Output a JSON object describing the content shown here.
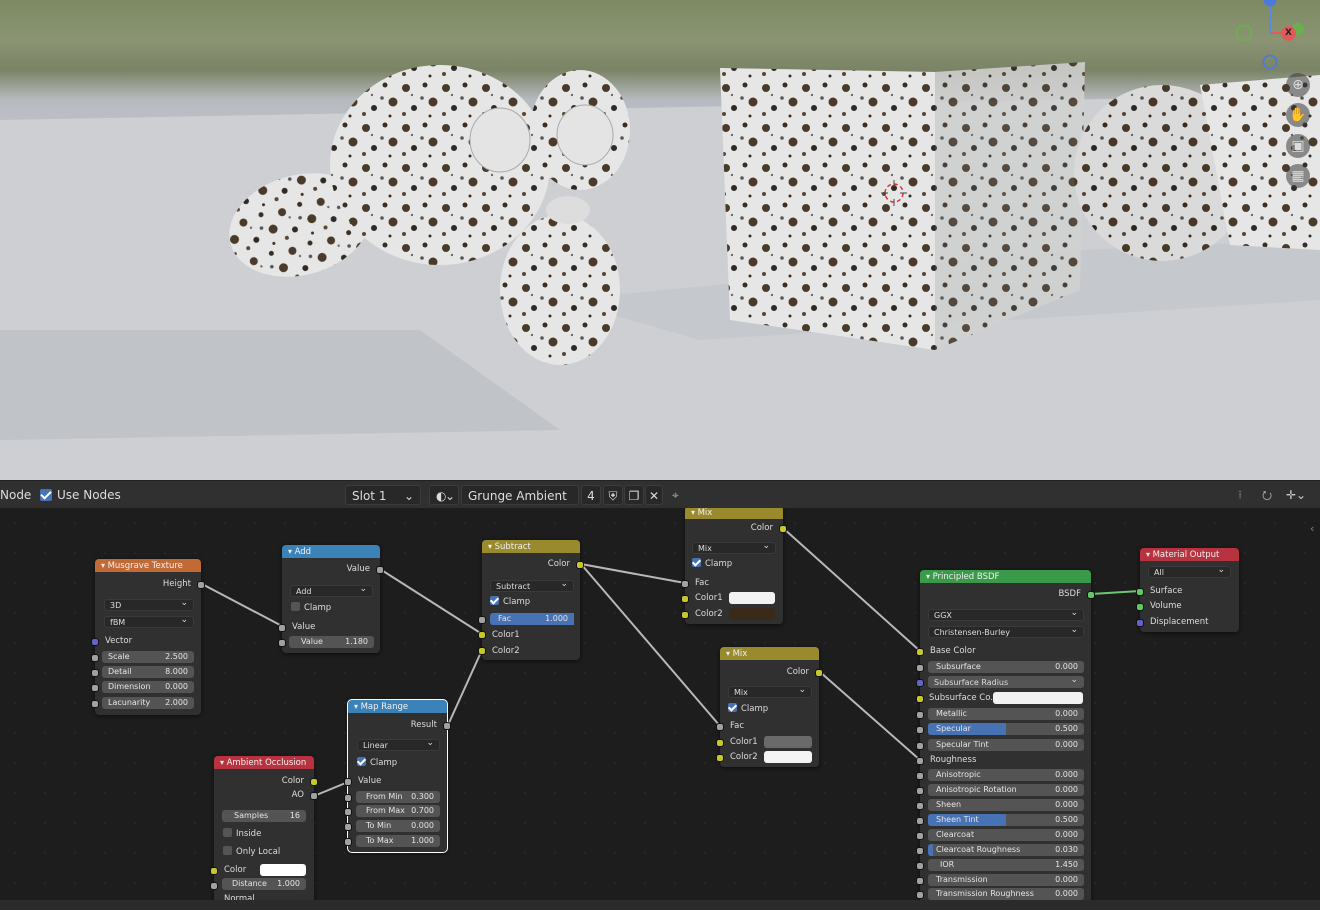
{
  "header": {
    "editor_label": "Node",
    "use_nodes_label": "Use Nodes",
    "slot": "Slot 1",
    "material_name": "Grunge Ambient",
    "user_count": "4"
  },
  "nodes": {
    "musgrave": {
      "title": "Musgrave Texture",
      "output_height": "Height",
      "dim": "3D",
      "type": "fBM",
      "vector": "Vector",
      "scale_label": "Scale",
      "scale": "2.500",
      "detail_label": "Detail",
      "detail": "8.000",
      "dimension_label": "Dimension",
      "dimension": "0.000",
      "lacunarity_label": "Lacunarity",
      "lacunarity": "2.000"
    },
    "add": {
      "title": "Add",
      "output_value": "Value",
      "op": "Add",
      "clamp": "Clamp",
      "input_value": "Value",
      "value_label": "Value",
      "value": "1.180"
    },
    "subtract": {
      "title": "Subtract",
      "output_color": "Color",
      "op": "Subtract",
      "clamp": "Clamp",
      "fac_label": "Fac",
      "fac": "1.000",
      "color1": "Color1",
      "color2": "Color2"
    },
    "mix1": {
      "title": "Mix",
      "output_color": "Color",
      "op": "Mix",
      "clamp": "Clamp",
      "fac": "Fac",
      "color1": "Color1",
      "color2": "Color2",
      "color1_hex": "#f2f2f2",
      "color2_hex": "#3a2a1a"
    },
    "mix2": {
      "title": "Mix",
      "output_color": "Color",
      "op": "Mix",
      "clamp": "Clamp",
      "fac": "Fac",
      "color1": "Color1",
      "color2": "Color2",
      "color1_hex": "#6a6a6a",
      "color2_hex": "#f4f4f4"
    },
    "map_range": {
      "title": "Map Range",
      "output_result": "Result",
      "interp": "Linear",
      "clamp": "Clamp",
      "input_value": "Value",
      "from_min_label": "From Min",
      "from_min": "0.300",
      "from_max_label": "From Max",
      "from_max": "0.700",
      "to_min_label": "To Min",
      "to_min": "0.000",
      "to_max_label": "To Max",
      "to_max": "1.000"
    },
    "ao": {
      "title": "Ambient Occlusion",
      "output_color": "Color",
      "output_ao": "AO",
      "samples_label": "Samples",
      "samples": "16",
      "inside": "Inside",
      "only_local": "Only Local",
      "color": "Color",
      "distance_label": "Distance",
      "distance": "1.000",
      "normal": "Normal"
    },
    "bsdf": {
      "title": "Principled BSDF",
      "output_bsdf": "BSDF",
      "distribution": "GGX",
      "subsurface_method": "Christensen-Burley",
      "base_color": "Base Color",
      "subsurface_label": "Subsurface",
      "subsurface": "0.000",
      "subsurface_radius": "Subsurface Radius",
      "subsurface_color": "Subsurface Co...",
      "metallic_label": "Metallic",
      "metallic": "0.000",
      "specular_label": "Specular",
      "specular": "0.500",
      "specular_tint_label": "Specular Tint",
      "specular_tint": "0.000",
      "roughness": "Roughness",
      "anisotropic_label": "Anisotropic",
      "anisotropic": "0.000",
      "anisotropic_rotation_label": "Anisotropic Rotation",
      "anisotropic_rotation": "0.000",
      "sheen_label": "Sheen",
      "sheen": "0.000",
      "sheen_tint_label": "Sheen Tint",
      "sheen_tint": "0.500",
      "clearcoat_label": "Clearcoat",
      "clearcoat": "0.000",
      "clearcoat_roughness_label": "Clearcoat Roughness",
      "clearcoat_roughness": "0.030",
      "ior_label": "IOR",
      "ior": "1.450",
      "transmission_label": "Transmission",
      "transmission": "0.000",
      "transmission_roughness_label": "Transmission Roughness",
      "transmission_roughness": "0.000"
    },
    "output": {
      "title": "Material Output",
      "target": "All",
      "surface": "Surface",
      "volume": "Volume",
      "displacement": "Displacement"
    }
  },
  "colors": {
    "texture_header": "#c16a35",
    "converter_header": "#3b82b8",
    "color_header": "#9a8a2e",
    "input_header": "#b8333f",
    "shader_header": "#3a9a4a",
    "output_header": "#b8333f",
    "socket_yellow": "#c7c729",
    "socket_gray": "#a1a1a1",
    "socket_green": "#63c763",
    "socket_purple": "#6363c7",
    "accent": "#4772b3"
  },
  "gizmo": {
    "x_label": "X"
  }
}
